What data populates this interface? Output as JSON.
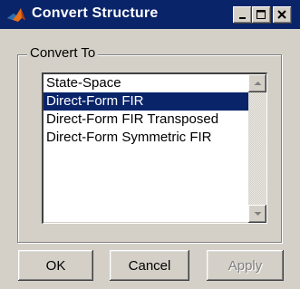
{
  "window": {
    "title": "Convert Structure",
    "colors": {
      "titlebar": "#0a246a",
      "face": "#d4d0c8",
      "selection": "#0a246a"
    }
  },
  "group": {
    "label": "Convert To"
  },
  "list": {
    "items": [
      {
        "label": "State-Space",
        "selected": false
      },
      {
        "label": "Direct-Form FIR",
        "selected": true
      },
      {
        "label": "Direct-Form FIR Transposed",
        "selected": false
      },
      {
        "label": "Direct-Form Symmetric FIR",
        "selected": false
      }
    ]
  },
  "buttons": {
    "ok": "OK",
    "cancel": "Cancel",
    "apply": "Apply"
  },
  "icons": {
    "app": "matlab-logo-icon",
    "minimize": "minimize-icon",
    "maximize": "maximize-icon",
    "close": "close-icon",
    "scroll_up": "arrow-up-icon",
    "scroll_down": "arrow-down-icon"
  }
}
